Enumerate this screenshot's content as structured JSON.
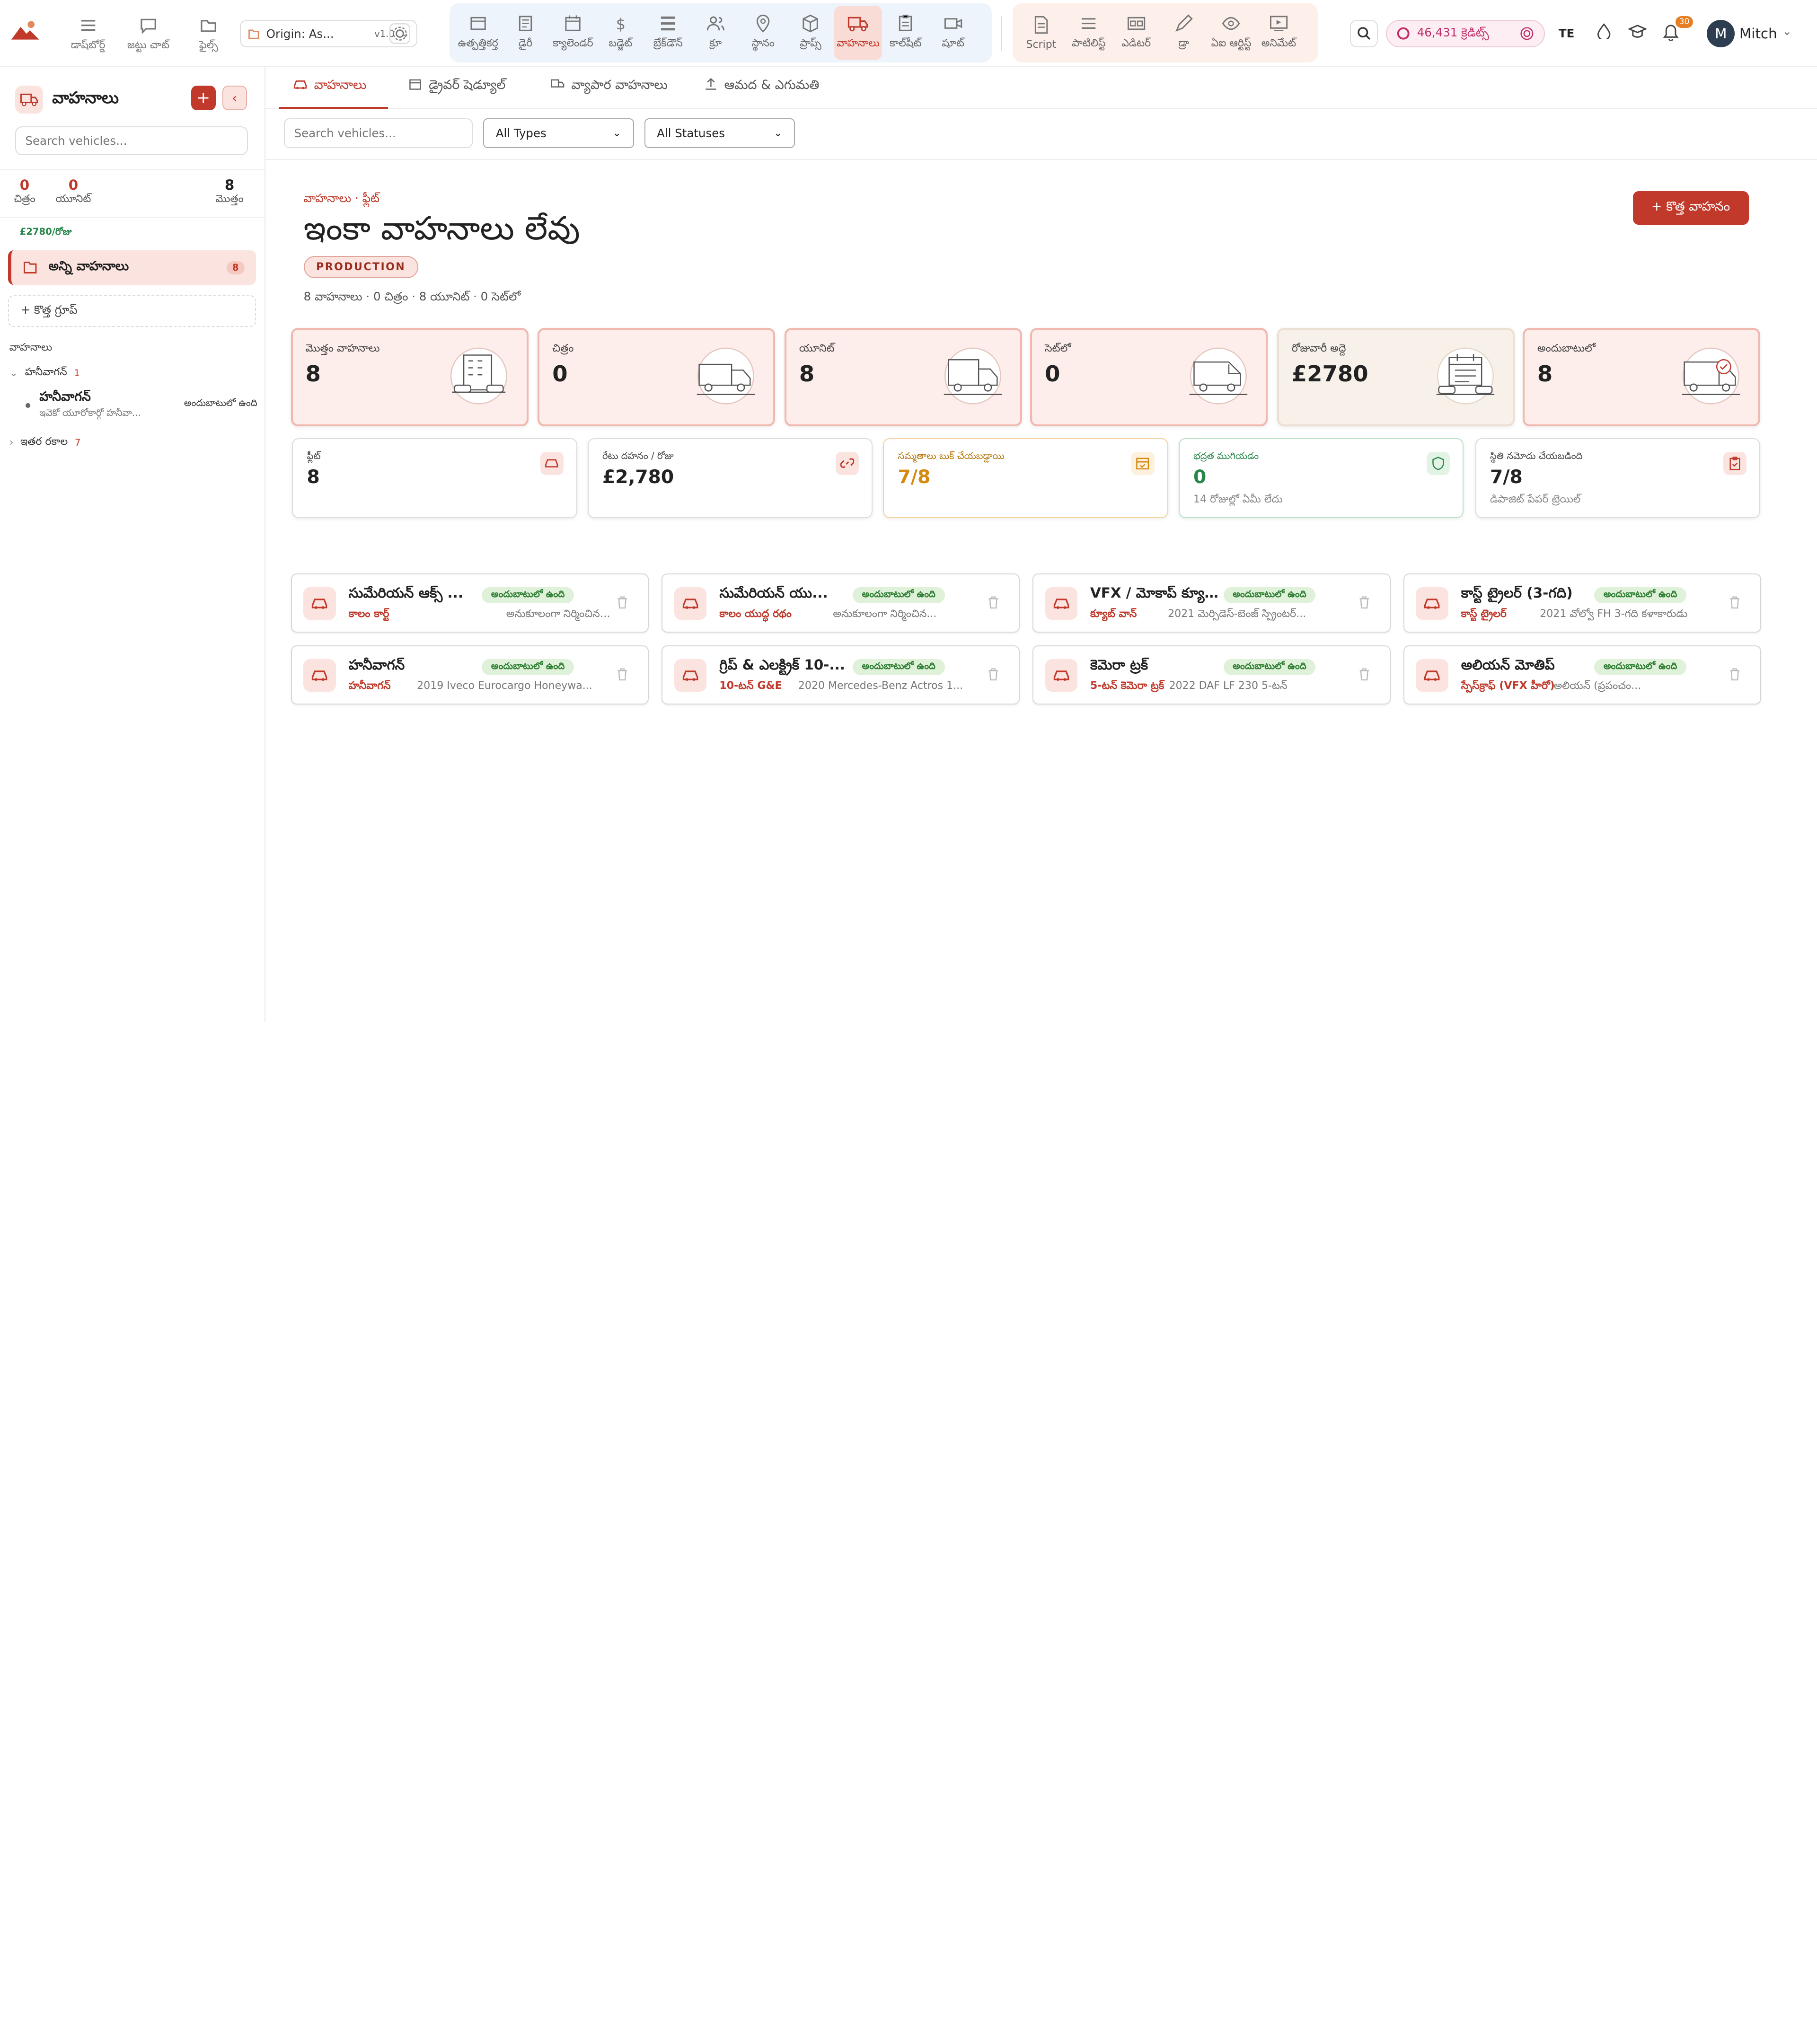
{
  "topnav": {
    "quick": [
      {
        "icon": "dashboard-icon",
        "label": "డాష్‌బోర్డ్"
      },
      {
        "icon": "team-chat-icon",
        "label": "జట్టు చాట్"
      },
      {
        "icon": "files-icon",
        "label": "ఫైల్స్"
      }
    ],
    "project": {
      "name": "Origin: As...",
      "version": "v1.0"
    },
    "modules": [
      {
        "icon": "production-icon",
        "label": "ఉత్పత్తికర్త"
      },
      {
        "icon": "diary-icon",
        "label": "డైరీ"
      },
      {
        "icon": "calendar-icon",
        "label": "క్యాలెండర్"
      },
      {
        "icon": "budget-icon",
        "label": "బడ్జెట్"
      },
      {
        "icon": "breakdown-icon",
        "label": "బ్రేక్‌డౌన్"
      },
      {
        "icon": "crew-icon",
        "label": "క్రూ"
      },
      {
        "icon": "locations-icon",
        "label": "స్థానం"
      },
      {
        "icon": "props-icon",
        "label": "ప్రాప్స్"
      },
      {
        "icon": "vehicles-icon",
        "label": "వాహనాలు",
        "active": true
      },
      {
        "icon": "call-sheet-icon",
        "label": "కాల్‌షీట్"
      },
      {
        "icon": "shoot-icon",
        "label": "షూట్"
      }
    ],
    "tools": [
      {
        "icon": "script-icon",
        "label": "Script"
      },
      {
        "icon": "outline-icon",
        "label": "పాటిలిస్ట్"
      },
      {
        "icon": "editor-icon",
        "label": "ఎడిటర్"
      },
      {
        "icon": "draw-icon",
        "label": "డ్రా"
      },
      {
        "icon": "ai-artist-icon",
        "label": "ఏఐ ఆర్టిస్ట్"
      },
      {
        "icon": "animate-icon",
        "label": "అనిమేట్"
      }
    ],
    "credits": "46,431 క్రెడిట్స్",
    "language": "TE",
    "notification_count": "30",
    "user": {
      "initial": "M",
      "name": "Mitch"
    }
  },
  "sidebar": {
    "title": "వాహనాలు",
    "search_placeholder": "Search vehicles...",
    "stats": [
      {
        "value": "0",
        "label": "చిత్రం"
      },
      {
        "value": "0",
        "label": "యూనిట్"
      },
      {
        "value": "8",
        "label": "మొత్తం"
      }
    ],
    "rate": "£2780/రోజు",
    "all_label": "అన్ని వాహనాలు",
    "all_count": "8",
    "new_group": "+ కొత్త గ్రూప్",
    "section_label": "వాహనాలు",
    "tree": [
      {
        "name": "హనీవాగన్",
        "count": "1"
      },
      {
        "name": "ఇతర రకాల",
        "count": "7"
      }
    ],
    "tree_item": {
      "title": "హనీవాగన్",
      "sub": "ఇవెకో యూరోకార్గో హనీవా...",
      "status": "అందుబాటులో ఉంది"
    }
  },
  "tabs": [
    {
      "icon": "vehicle-tab-icon",
      "label": "వాహనాలు",
      "active": true
    },
    {
      "icon": "schedule-tab-icon",
      "label": "డ్రైవర్ షెడ్యూల్"
    },
    {
      "icon": "commercial-tab-icon",
      "label": "వ్యాపార వాహనాలు"
    },
    {
      "icon": "import-export-icon",
      "label": "ఆమద & ఎగుమతి"
    }
  ],
  "filters": {
    "search_placeholder": "Search vehicles...",
    "type": "All Types",
    "status": "All Statuses"
  },
  "page": {
    "breadcrumb": "వాహనాలు · ఫ్లీట్",
    "title": "ఇంకా వాహనాలు లేవు",
    "badge": "PRODUCTION",
    "summary": "8 వాహనాలు · 0 చిత్రం · 8 యూనిట్ · 0 సెట్‌లో",
    "new_button": "+ కొత్త వాహనం"
  },
  "stat_cards": [
    {
      "label": "మొత్తం వాహనాలు",
      "value": "8"
    },
    {
      "label": "చిత్రం",
      "value": "0"
    },
    {
      "label": "యూనిట్",
      "value": "8"
    },
    {
      "label": "సెట్‌లో",
      "value": "0"
    },
    {
      "label": "రోజువారీ అద్దె",
      "value": "£2780"
    },
    {
      "label": "అందుబాటులో",
      "value": "8"
    }
  ],
  "mini_cards": [
    {
      "label": "ఫ్లీట్",
      "value": "8",
      "sub": "",
      "icon": "car-icon",
      "color": "#c0392b",
      "bg": "#fbe4df"
    },
    {
      "label": "రేటు దహనం / రోజు",
      "value": "£2,780",
      "sub": "",
      "icon": "link-icon",
      "color": "#c0392b",
      "bg": "#fbe4df"
    },
    {
      "label": "సమ్మతాలు బుక్ చేయబడ్డాయి",
      "value": "7/8",
      "sub": "",
      "icon": "calendar-check-icon",
      "color": "#d68910",
      "bg": "#fdf0dd"
    },
    {
      "label": "భద్రత ముగియడం",
      "value": "0",
      "sub": "14 రోజుల్లో ఏమీ లేదు",
      "icon": "shield-icon",
      "color": "#27874a",
      "bg": "#e3f4e6"
    },
    {
      "label": "స్థితి నమోదు చేయబడింది",
      "value": "7/8",
      "sub": "డిపాజిట్ పేపర్ ట్రెయిల్",
      "icon": "clipboard-icon",
      "color": "#c0392b",
      "bg": "#fbe4df"
    }
  ],
  "vehicles": [
    {
      "name": "సుమేరియన్ ఆక్స్ ...",
      "status": "అందుబాటులో ఉంది",
      "type": "కాలం కార్ట్",
      "desc": "అనుకూలంగా నిర్మించిన బ్రాంజ్-..."
    },
    {
      "name": "సుమేరియన్ యు...",
      "status": "అందుబాటులో ఉంది",
      "type": "కాలం యుద్ధ రథం",
      "desc": "అనుకూలంగా నిర్మించిన..."
    },
    {
      "name": "VFX / మోకాప్ క్యూ...",
      "status": "అందుబాటులో ఉంది",
      "type": "క్యూబ్ వాన్",
      "desc": "2021 మెర్సిడెస్-బెంజ్ స్ప్రింటర్..."
    },
    {
      "name": "కాస్ట్ ట్రైలర్ (3-గది)",
      "status": "అందుబాటులో ఉంది",
      "type": "కాస్ట్ ట్రైలర్",
      "desc": "2021 వోల్వో FH 3-గది కళాకారుడు"
    },
    {
      "name": "హనీవాగన్",
      "status": "అందుబాటులో ఉంది",
      "type": "హనీవాగన్",
      "desc": "2019 Iveco Eurocargo Honeywa..."
    },
    {
      "name": "గ్రిప్ & ఎలక్ట్రిక్ 10-...",
      "status": "అందుబాటులో ఉంది",
      "type": "10-టన్ G&E",
      "desc": "2020 Mercedes-Benz Actros 1..."
    },
    {
      "name": "కెమెరా ట్రక్",
      "status": "అందుబాటులో ఉంది",
      "type": "5-టన్ కెమెరా ట్రక్",
      "desc": "2022 DAF LF 230 5-టన్"
    },
    {
      "name": "అలియన్ మోతిప్",
      "status": "అందుబాటులో ఉంది",
      "type": "స్పేస్‌క్రాఫ్ (VFX హీరో)",
      "desc": "అలియన్ (ప్రపంచం..."
    }
  ]
}
